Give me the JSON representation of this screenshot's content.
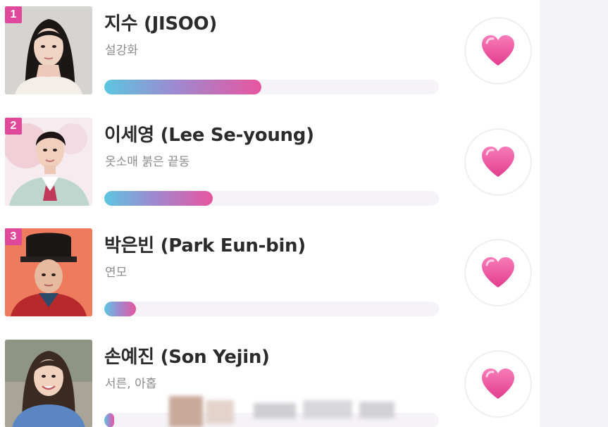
{
  "ranking": {
    "items": [
      {
        "rank": "1",
        "name": "지수 (JISOO)",
        "work": "설강화",
        "vote_share": 0.47,
        "like_icon": "heart-icon"
      },
      {
        "rank": "2",
        "name": "이세영 (Lee Se-young)",
        "work": "옷소매 붉은 끝동",
        "vote_share": 0.325,
        "like_icon": "heart-icon"
      },
      {
        "rank": "3",
        "name": "박은빈 (Park Eun-bin)",
        "work": "연모",
        "vote_share": 0.095,
        "like_icon": "heart-icon"
      },
      {
        "name": "손예진 (Son Yejin)",
        "work": "서른, 아홉",
        "vote_share": 0.03,
        "like_icon": "heart-icon"
      }
    ]
  },
  "colors": {
    "rank_badge": "#e0489b",
    "bar_start": "#5cc6df",
    "bar_end": "#e8559f",
    "heart": "#ef4a99",
    "track": "#f5f3f7"
  }
}
